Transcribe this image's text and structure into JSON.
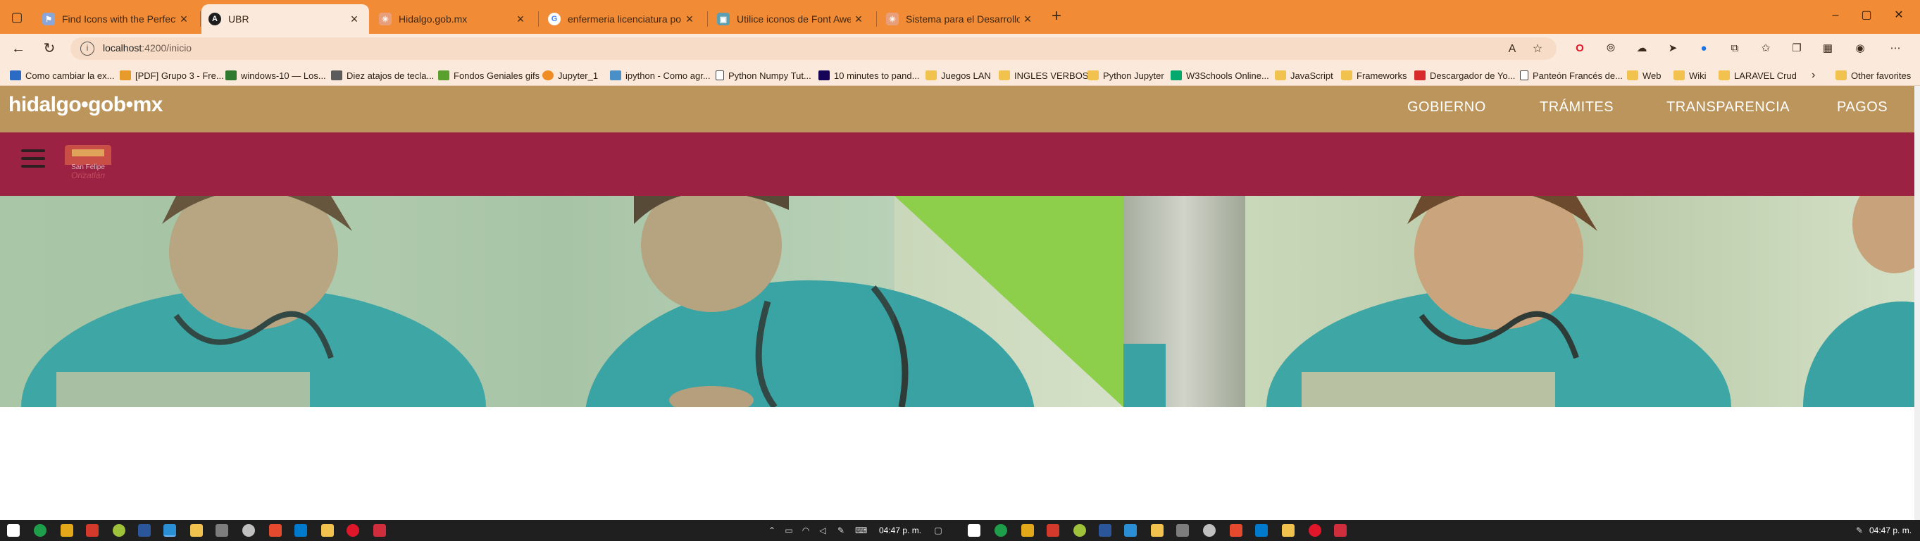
{
  "browser": {
    "tabs": [
      {
        "title": "Find Icons with the Perfect Look",
        "icon": "flag-icon",
        "active": false
      },
      {
        "title": "UBR",
        "icon": "angular-icon",
        "active": true
      },
      {
        "title": "Hidalgo.gob.mx",
        "icon": "hidalgo-site-icon",
        "active": false
      },
      {
        "title": "enfermeria licenciatura portada",
        "icon": "google-icon",
        "active": false
      },
      {
        "title": "Utilice iconos de Font Awesome",
        "icon": "image-icon",
        "active": false
      },
      {
        "title": "Sistema para el Desarrollo Integ",
        "icon": "hidalgo-site-icon",
        "active": false
      }
    ],
    "address": {
      "host": "localhost",
      "path": ":4200/inicio"
    },
    "bookmarks": [
      {
        "label": "Como cambiar la ex...",
        "type": "site"
      },
      {
        "label": "[PDF] Grupo 3 - Fre...",
        "type": "site"
      },
      {
        "label": "windows-10 — Los...",
        "type": "site"
      },
      {
        "label": "Diez atajos de tecla...",
        "type": "site"
      },
      {
        "label": "Fondos Geniales gifs",
        "type": "site"
      },
      {
        "label": "Jupyter_1",
        "type": "site"
      },
      {
        "label": "ipython - Como agr...",
        "type": "site"
      },
      {
        "label": "Python Numpy Tut...",
        "type": "page"
      },
      {
        "label": "10 minutes to pand...",
        "type": "site"
      },
      {
        "label": "Juegos LAN",
        "type": "folder"
      },
      {
        "label": "INGLES VERBOS",
        "type": "folder"
      },
      {
        "label": "Python Jupyter",
        "type": "folder"
      },
      {
        "label": "W3Schools Online...",
        "type": "site"
      },
      {
        "label": "JavaScript",
        "type": "folder"
      },
      {
        "label": "Frameworks",
        "type": "folder"
      },
      {
        "label": "Descargador de Yo...",
        "type": "site"
      },
      {
        "label": "Panteón Francés de...",
        "type": "page"
      },
      {
        "label": "Web",
        "type": "folder"
      },
      {
        "label": "Wiki",
        "type": "folder"
      },
      {
        "label": "LARAVEL Crud",
        "type": "folder"
      }
    ],
    "other_favorites": "Other favorites"
  },
  "site": {
    "brand": "hidalgo•gob•mx",
    "nav": [
      "GOBIERNO",
      "TRÁMITES",
      "TRANSPARENCIA",
      "PAGOS"
    ],
    "logo": {
      "line1": "San Felipe",
      "line2": "Orizatlán"
    },
    "colors": {
      "gold": "#bc955c",
      "guinda": "#9b2242",
      "accent_green": "#8dcf4a"
    }
  },
  "taskbar": {
    "time_center": "04:47 p. m.",
    "time_right": "04:47 p. m."
  }
}
